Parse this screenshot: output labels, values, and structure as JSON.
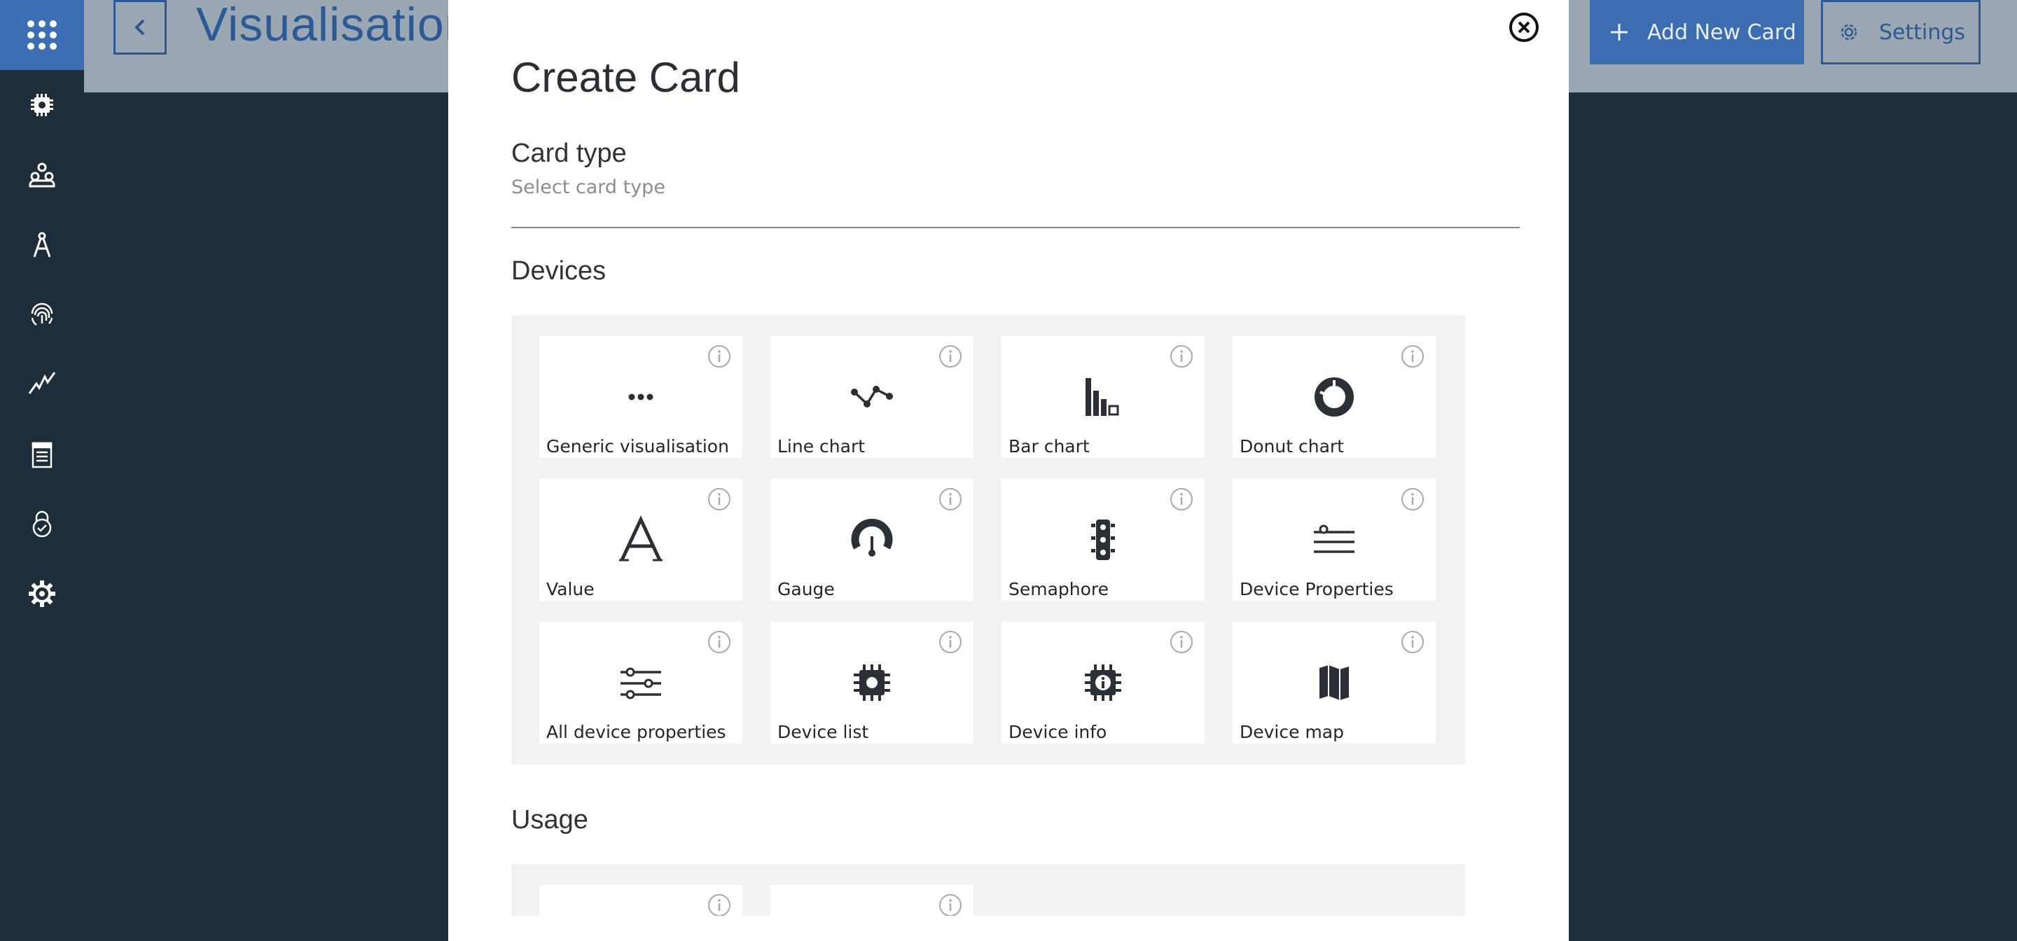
{
  "header": {
    "page_title": "Visualisation",
    "add_button_label": "Add New Card",
    "settings_button_label": "Settings"
  },
  "nav": {
    "items": [
      "devices",
      "members",
      "apps",
      "security",
      "analytics",
      "rules",
      "compliance",
      "settings"
    ]
  },
  "modal": {
    "title": "Create Card",
    "card_type_label": "Card type",
    "card_type_placeholder": "Select card type",
    "sections": [
      {
        "title": "Devices",
        "tiles": [
          {
            "label": "Generic visualisation",
            "icon": "dots-icon"
          },
          {
            "label": "Line chart",
            "icon": "line-chart-icon"
          },
          {
            "label": "Bar chart",
            "icon": "bar-chart-icon"
          },
          {
            "label": "Donut chart",
            "icon": "donut-chart-icon"
          },
          {
            "label": "Value",
            "icon": "letter-a-icon"
          },
          {
            "label": "Gauge",
            "icon": "gauge-icon"
          },
          {
            "label": "Semaphore",
            "icon": "traffic-light-icon"
          },
          {
            "label": "Device Properties",
            "icon": "properties-icon"
          },
          {
            "label": "All device properties",
            "icon": "sliders-icon"
          },
          {
            "label": "Device list",
            "icon": "chip-icon"
          },
          {
            "label": "Device info",
            "icon": "chip-info-icon"
          },
          {
            "label": "Device map",
            "icon": "map-icon"
          }
        ]
      },
      {
        "title": "Usage",
        "tiles": [
          {
            "label": "",
            "icon": ""
          },
          {
            "label": "",
            "icon": ""
          }
        ]
      }
    ]
  },
  "colors": {
    "accent": "#3c6db0",
    "rail": "#1d2d39",
    "backdrop": "#1e2f3b",
    "panel": "#f0f2f4"
  }
}
